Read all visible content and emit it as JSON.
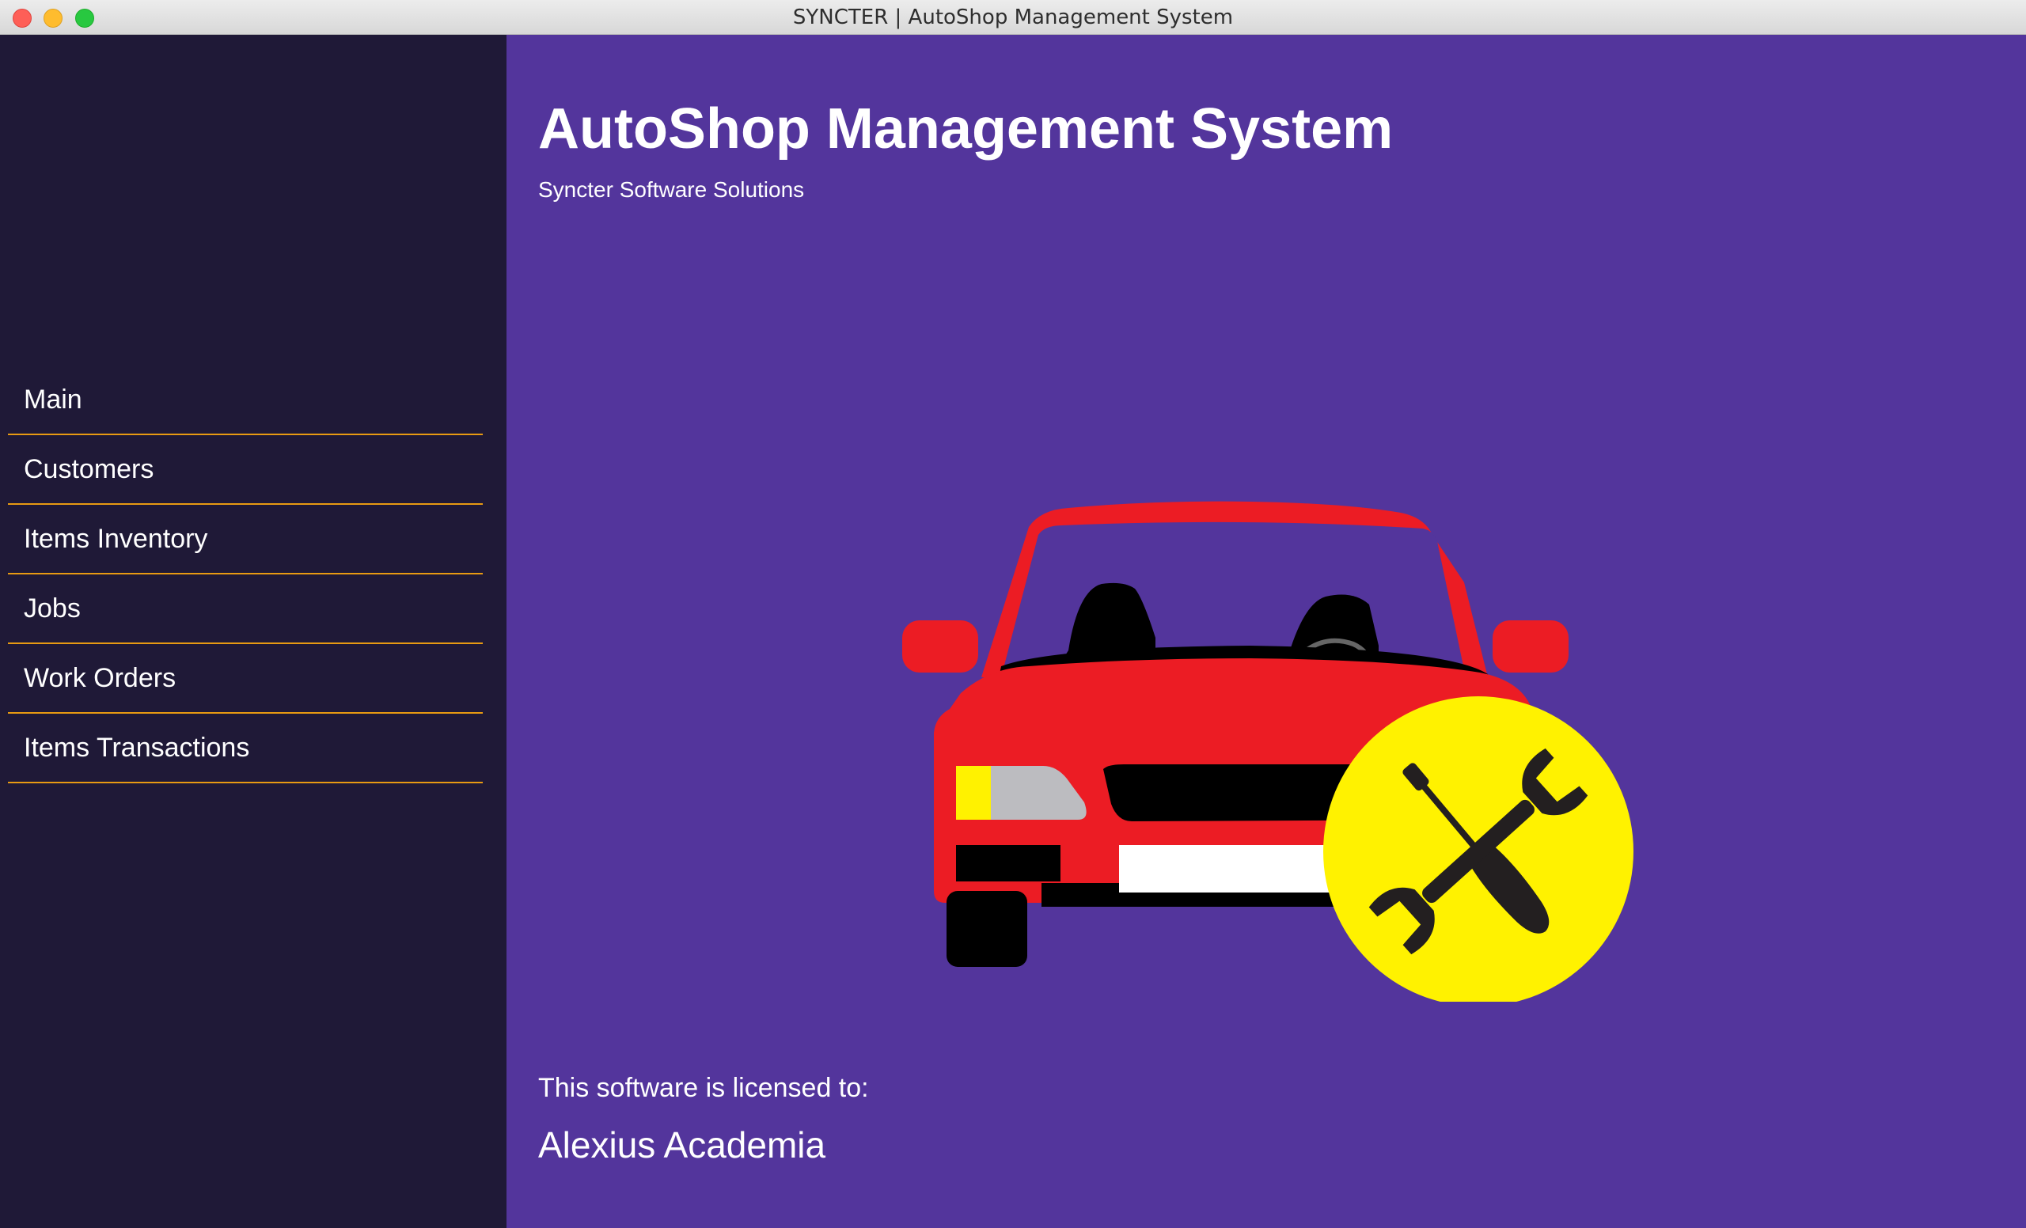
{
  "window": {
    "title": "SYNCTER | AutoShop Management System"
  },
  "sidebar": {
    "items": [
      {
        "label": "Main"
      },
      {
        "label": "Customers"
      },
      {
        "label": "Items Inventory"
      },
      {
        "label": "Jobs"
      },
      {
        "label": "Work Orders"
      },
      {
        "label": "Items Transactions"
      }
    ]
  },
  "main": {
    "title": "AutoShop Management System",
    "subtitle": "Syncter Software Solutions",
    "hero_image": "car-repair-icon",
    "license_label": "This software is licensed to:",
    "licensee": "Alexius Academia"
  },
  "colors": {
    "sidebar_bg": "#1f1937",
    "main_bg": "#53359c",
    "nav_divider": "#e89a12",
    "car_red": "#ec1c24",
    "badge_yellow": "#fff200"
  }
}
